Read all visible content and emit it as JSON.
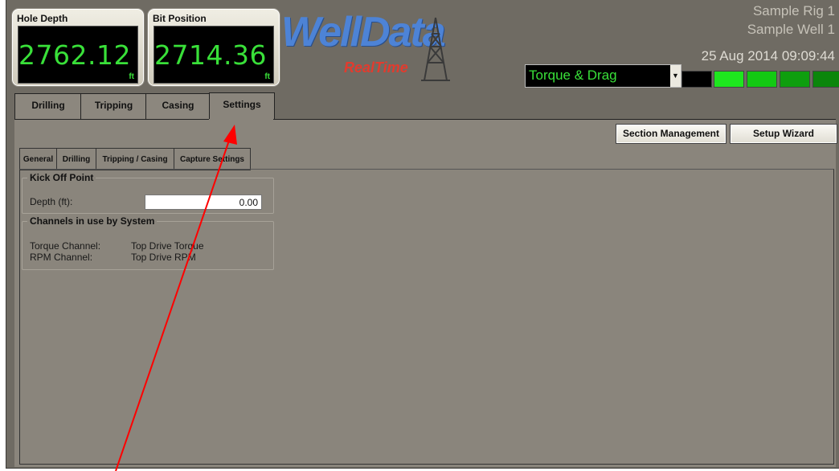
{
  "gauges": {
    "hole_depth": {
      "title": "Hole Depth",
      "value": "2762.12",
      "unit": "ft"
    },
    "bit_position": {
      "title": "Bit Position",
      "value": "2714.36",
      "unit": "ft"
    }
  },
  "logo": {
    "main": "WellData",
    "sub": "RealTime",
    "icon": "derrick-icon"
  },
  "header": {
    "rig": "Sample Rig 1",
    "well": "Sample Well 1",
    "datetime": "25 Aug 2014 09:09:44"
  },
  "mode_select": {
    "value": "Torque & Drag"
  },
  "indicators": [
    "#000000",
    "#1ee61e",
    "#13c913",
    "#0e9e0e",
    "#0b860b"
  ],
  "main_tabs": [
    "Drilling",
    "Tripping",
    "Casing",
    "Settings"
  ],
  "buttons": {
    "section_management": "Section Management",
    "setup_wizard": "Setup Wizard"
  },
  "sub_tabs": [
    "General",
    "Drilling",
    "Tripping / Casing",
    "Capture Settings"
  ],
  "kick_off": {
    "title": "Kick Off Point",
    "depth_label": "Depth (ft):",
    "depth_value": "0.00"
  },
  "channels": {
    "title": "Channels in use by System",
    "torque_label": "Torque Channel:",
    "torque_value": "Top Drive Torque",
    "rpm_label": "RPM Channel:",
    "rpm_value": "Top Drive RPM"
  },
  "colors": {
    "accent_green": "#39e039",
    "annotation_arrow": "#ff0000",
    "logo_blue": "#4d83d6",
    "logo_red": "#e23b2e"
  }
}
